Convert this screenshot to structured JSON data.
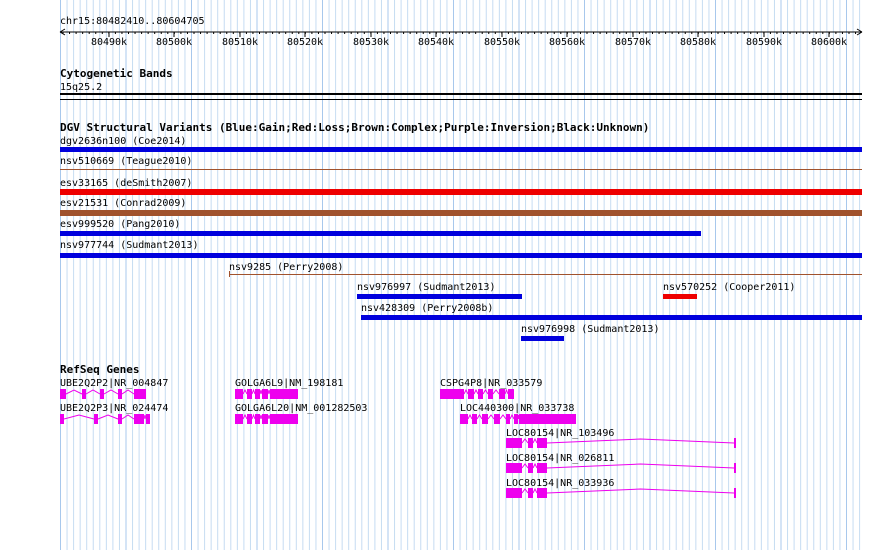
{
  "ruler": {
    "title": "chr15:80482410..80604705",
    "ticks": [
      "80490k",
      "80500k",
      "80510k",
      "80520k",
      "80530k",
      "80540k",
      "80550k",
      "80560k",
      "80570k",
      "80580k",
      "80590k",
      "80600k"
    ]
  },
  "cytobands": {
    "header": "Cytogenetic Bands",
    "band": "15q25.2"
  },
  "dgv": {
    "header": "DGV Structural Variants (Blue:Gain;Red:Loss;Brown:Complex;Purple:Inversion;Black:Unknown)",
    "colors": {
      "gain": "#0000dd",
      "loss": "#ee0000",
      "complex": "#a0522d",
      "thin": "#a0522d"
    },
    "variants": [
      {
        "label": "dgv2636n100 (Coe2014)",
        "type": "gain"
      },
      {
        "label": "nsv510669 (Teague2010)",
        "type": "thin"
      },
      {
        "label": "esv33165 (deSmith2007)",
        "type": "loss"
      },
      {
        "label": "esv21531 (Conrad2009)",
        "type": "complex"
      },
      {
        "label": "esv999520 (Pang2010)",
        "type": "gain"
      },
      {
        "label": "nsv977744 (Sudmant2013)",
        "type": "gain"
      },
      {
        "label": "nsv9285 (Perry2008)",
        "type": "thin"
      },
      {
        "label": "nsv976997 (Sudmant2013)",
        "type": "gain"
      },
      {
        "label": "nsv570252 (Cooper2011)",
        "type": "loss"
      },
      {
        "label": "nsv428309 (Perry2008b)",
        "type": "gain"
      },
      {
        "label": "nsv976998 (Sudmant2013)",
        "type": "gain"
      }
    ]
  },
  "refseq": {
    "header": "RefSeq Genes",
    "color": "#ee00ee",
    "genes": [
      {
        "label": "UBE2Q2P2|NR_004847"
      },
      {
        "label": "UBE2Q2P3|NR_024474"
      },
      {
        "label": "GOLGA6L9|NM_198181"
      },
      {
        "label": "GOLGA6L20|NM_001282503"
      },
      {
        "label": "CSPG4P8|NR_033579"
      },
      {
        "label": "LOC440300|NR_033738"
      },
      {
        "label": "LOC80154|NR_103496"
      },
      {
        "label": "LOC80154|NR_026811"
      },
      {
        "label": "LOC80154|NR_033936"
      }
    ]
  }
}
